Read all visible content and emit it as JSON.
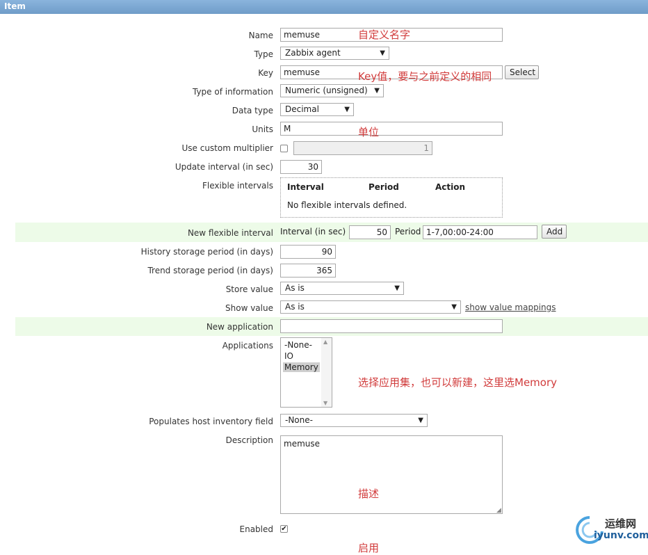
{
  "header": {
    "title": "Item"
  },
  "labels": {
    "name": "Name",
    "type": "Type",
    "key": "Key",
    "type_of_information": "Type of information",
    "data_type": "Data type",
    "units": "Units",
    "use_custom_multiplier": "Use custom multiplier",
    "update_interval": "Update interval (in sec)",
    "flexible_intervals": "Flexible intervals",
    "new_flexible_interval": "New flexible interval",
    "history_storage": "History storage period (in days)",
    "trend_storage": "Trend storage period (in days)",
    "store_value": "Store value",
    "show_value": "Show value",
    "new_application": "New application",
    "applications": "Applications",
    "populates_host_inventory": "Populates host inventory field",
    "description": "Description",
    "enabled": "Enabled"
  },
  "fields": {
    "name": "memuse",
    "type": "Zabbix agent",
    "key": "memuse",
    "select_button": "Select",
    "type_of_information": "Numeric (unsigned)",
    "data_type": "Decimal",
    "units": "M",
    "multiplier": "1",
    "multiplier_checked": false,
    "update_interval": "30",
    "flex_interval_label": "Interval (in sec)",
    "flex_interval": "50",
    "flex_period_label": "Period",
    "flex_period": "1-7,00:00-24:00",
    "add_button": "Add",
    "history_storage": "90",
    "trend_storage": "365",
    "store_value": "As is",
    "show_value": "As is",
    "show_value_mappings_link": "show value mappings",
    "new_application": "",
    "inventory_field": "-None-",
    "description": "memuse",
    "enabled": true
  },
  "flexible_table": {
    "columns": [
      "Interval",
      "Period",
      "Action"
    ],
    "empty_text": "No flexible intervals defined."
  },
  "applications": {
    "options": [
      "-None-",
      "IO",
      "Memory"
    ],
    "selected": "Memory"
  },
  "annotations": {
    "name": "自定义名字",
    "key": "Key值，要与之前定义的相同",
    "units": "单位",
    "applications": "选择应用集，也可以新建，这里选Memory",
    "description": "描述",
    "enabled": "启用"
  },
  "watermark": {
    "cn": "运维网",
    "en": "iyunv.com"
  },
  "colors": {
    "header": "#7aa7d3",
    "band": "#edfbe8",
    "annotation": "#d13b3b"
  }
}
